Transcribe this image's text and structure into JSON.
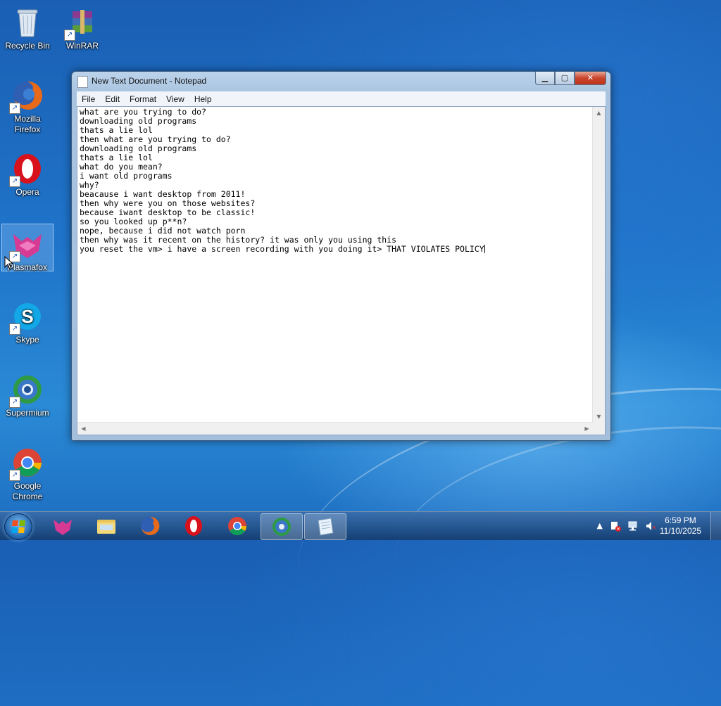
{
  "desktop": {
    "icons": [
      {
        "label": "Recycle Bin",
        "icon": "recycle-bin-icon"
      },
      {
        "label": "WinRAR",
        "icon": "winrar-icon"
      },
      {
        "label": "Mozilla Firefox",
        "icon": "firefox-icon"
      },
      {
        "label": "Opera",
        "icon": "opera-icon"
      },
      {
        "label": "Plasmafox",
        "icon": "plasmafox-icon"
      },
      {
        "label": "Skype",
        "icon": "skype-icon"
      },
      {
        "label": "Supermium",
        "icon": "supermium-icon"
      },
      {
        "label": "Google Chrome",
        "icon": "chrome-icon"
      }
    ]
  },
  "notepad": {
    "title": "New Text Document - Notepad",
    "menu": [
      "File",
      "Edit",
      "Format",
      "View",
      "Help"
    ],
    "lines": [
      "what are you trying to do?",
      "downloading old programs",
      "thats a lie lol",
      "then what are you trying to do?",
      "downloading old programs",
      "thats a lie lol",
      "what do you mean?",
      "i want old programs",
      "why?",
      "beacause i want desktop from 2011!",
      "then why were you on those websites?",
      "because iwant desktop to be classic!",
      "so you looked up p**n?",
      "nope, because i did not watch porn",
      "then why was it recent on the history? it was only you using this",
      "you reset the vm> i have a screen recording with you doing it> THAT VIOLATES POLICY"
    ]
  },
  "taskbar": {
    "pinned": [
      "plasmafox-icon",
      "explorer-icon",
      "firefox-icon",
      "opera-icon",
      "chrome-icon",
      "supermium-icon",
      "notepad-icon"
    ],
    "clock": {
      "time": "6:59 PM",
      "date": "11/10/2025"
    }
  },
  "colors": {
    "accent": "#1f74c9",
    "close": "#c9452c"
  }
}
